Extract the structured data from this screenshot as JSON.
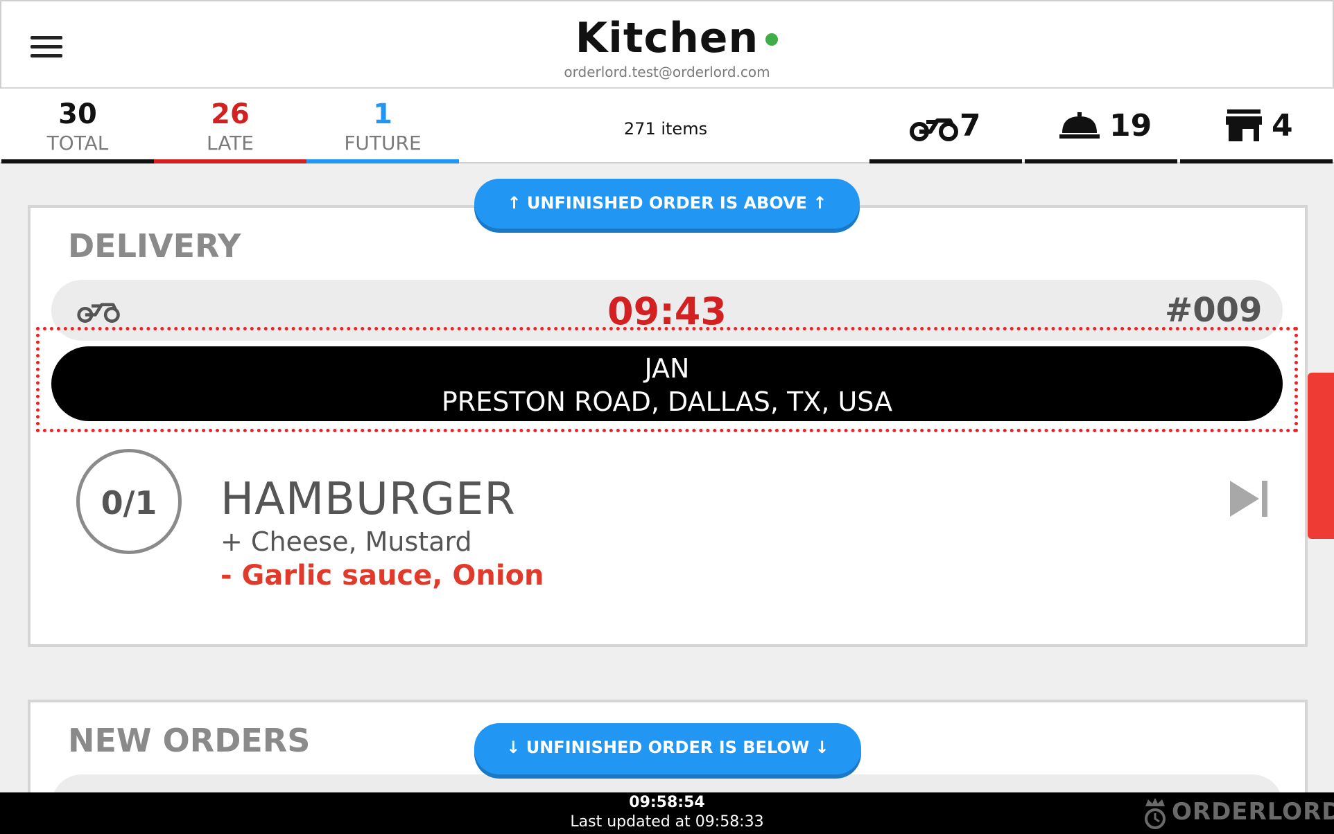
{
  "header": {
    "title": "Kitchen",
    "email": "orderlord.test@orderlord.com",
    "status_color": "#3fae49",
    "menu_icon": "hamburger-menu-icon"
  },
  "stats": {
    "total": {
      "value": "30",
      "label": "TOTAL",
      "color": "#111111"
    },
    "late": {
      "value": "26",
      "label": "LATE",
      "color": "#d32121"
    },
    "future": {
      "value": "1",
      "label": "FUTURE",
      "color": "#2196f3"
    },
    "items": "271 items"
  },
  "type_counts": {
    "delivery": {
      "icon": "motorbike-icon",
      "value": "7"
    },
    "dine_in": {
      "icon": "cloche-icon",
      "value": "19"
    },
    "pickup": {
      "icon": "store-icon",
      "value": "4"
    }
  },
  "nav": {
    "above_label": "↑ UNFINISHED ORDER IS ABOVE ↑",
    "below_label": "↓ UNFINISHED ORDER IS BELOW ↓"
  },
  "delivery_section": {
    "title": "DELIVERY",
    "order": {
      "icon": "motorbike-icon",
      "time": "09:43",
      "number": "#009",
      "customer": "JAN",
      "address": "PRESTON ROAD, DALLAS, TX, USA",
      "items": [
        {
          "quantity": "0/1",
          "name": "HAMBURGER",
          "additions": "+ Cheese, Mustard",
          "removals": "- Garlic sauce, Onion"
        }
      ]
    }
  },
  "new_orders_section": {
    "title": "NEW ORDERS"
  },
  "footer": {
    "clock": "09:58:54",
    "updated": "Last updated at 09:58:33",
    "brand": "ORDERLORD"
  }
}
